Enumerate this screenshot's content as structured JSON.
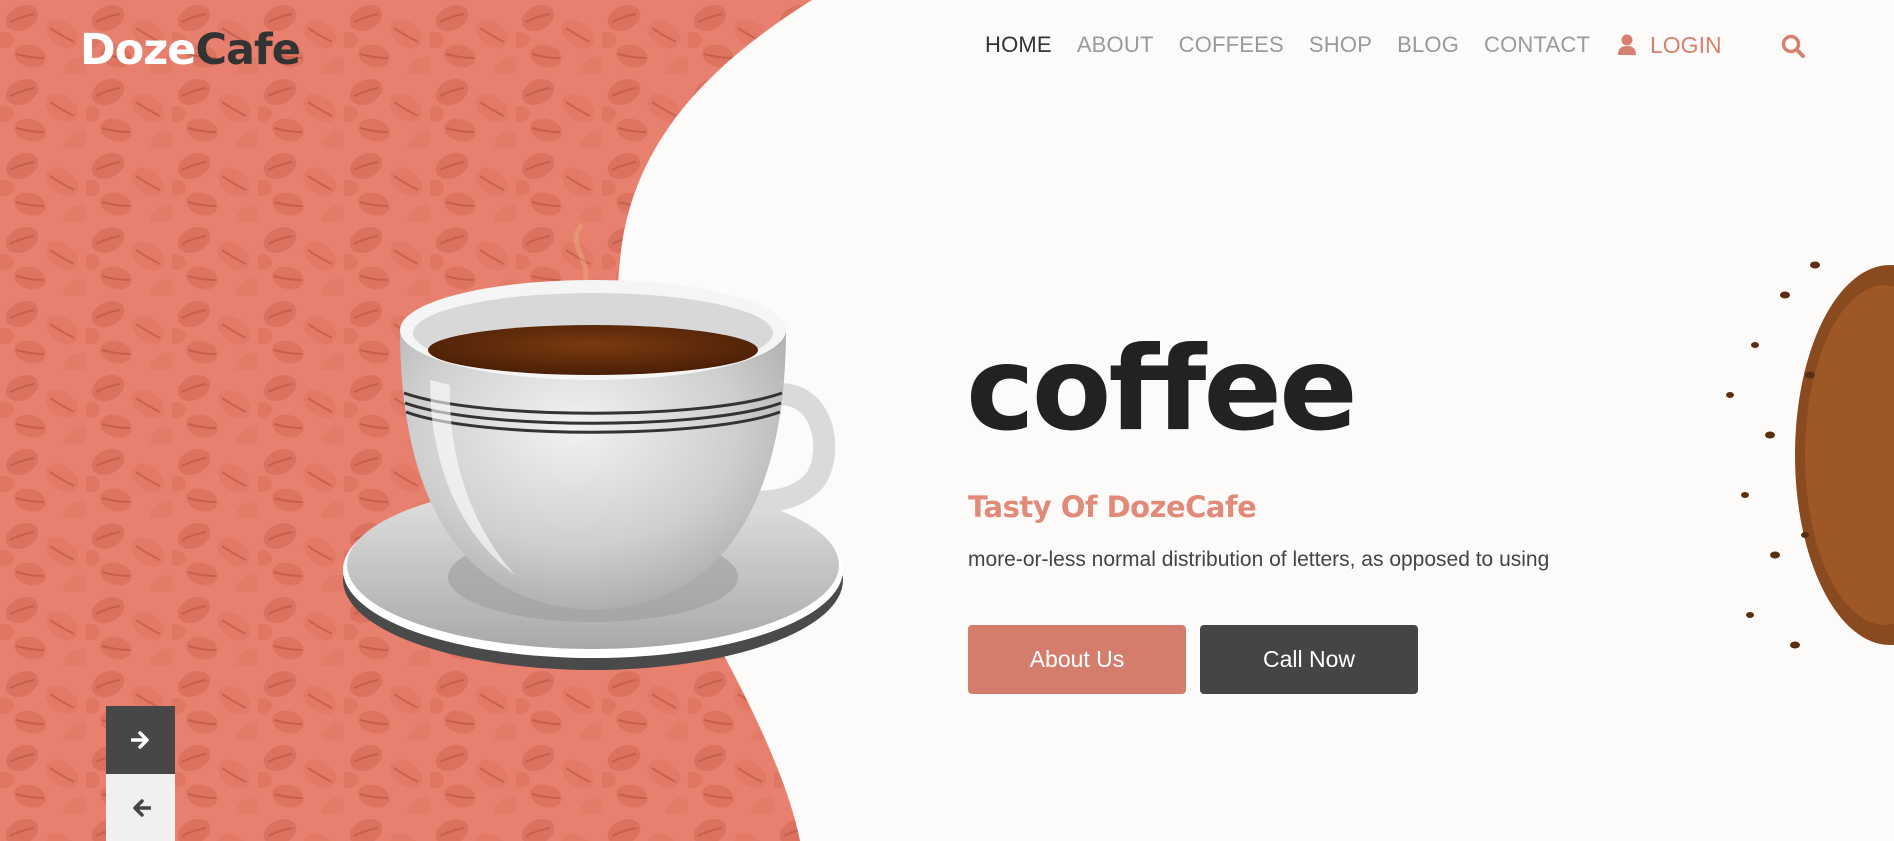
{
  "brand": {
    "part1": "Doze",
    "part2": "Cafe"
  },
  "nav": {
    "items": [
      {
        "label": "HOME",
        "active": true
      },
      {
        "label": "ABOUT",
        "active": false
      },
      {
        "label": "COFFEES",
        "active": false
      },
      {
        "label": "SHOP",
        "active": false
      },
      {
        "label": "BLOG",
        "active": false
      },
      {
        "label": "CONTACT",
        "active": false
      }
    ],
    "login_label": "LOGIN"
  },
  "hero": {
    "title": "coffee",
    "subtitle": "Tasty Of DozeCafe",
    "description": "more-or-less normal distribution of letters, as opposed to using",
    "primary_button": "About Us",
    "secondary_button": "Call Now"
  },
  "icons": {
    "login": "user-icon",
    "search": "search-icon",
    "next": "arrow-right-icon",
    "prev": "arrow-left-icon"
  },
  "colors": {
    "accent": "#d6806f",
    "bean_panel": "#e8836f",
    "dark": "#454545",
    "title": "#222222"
  }
}
